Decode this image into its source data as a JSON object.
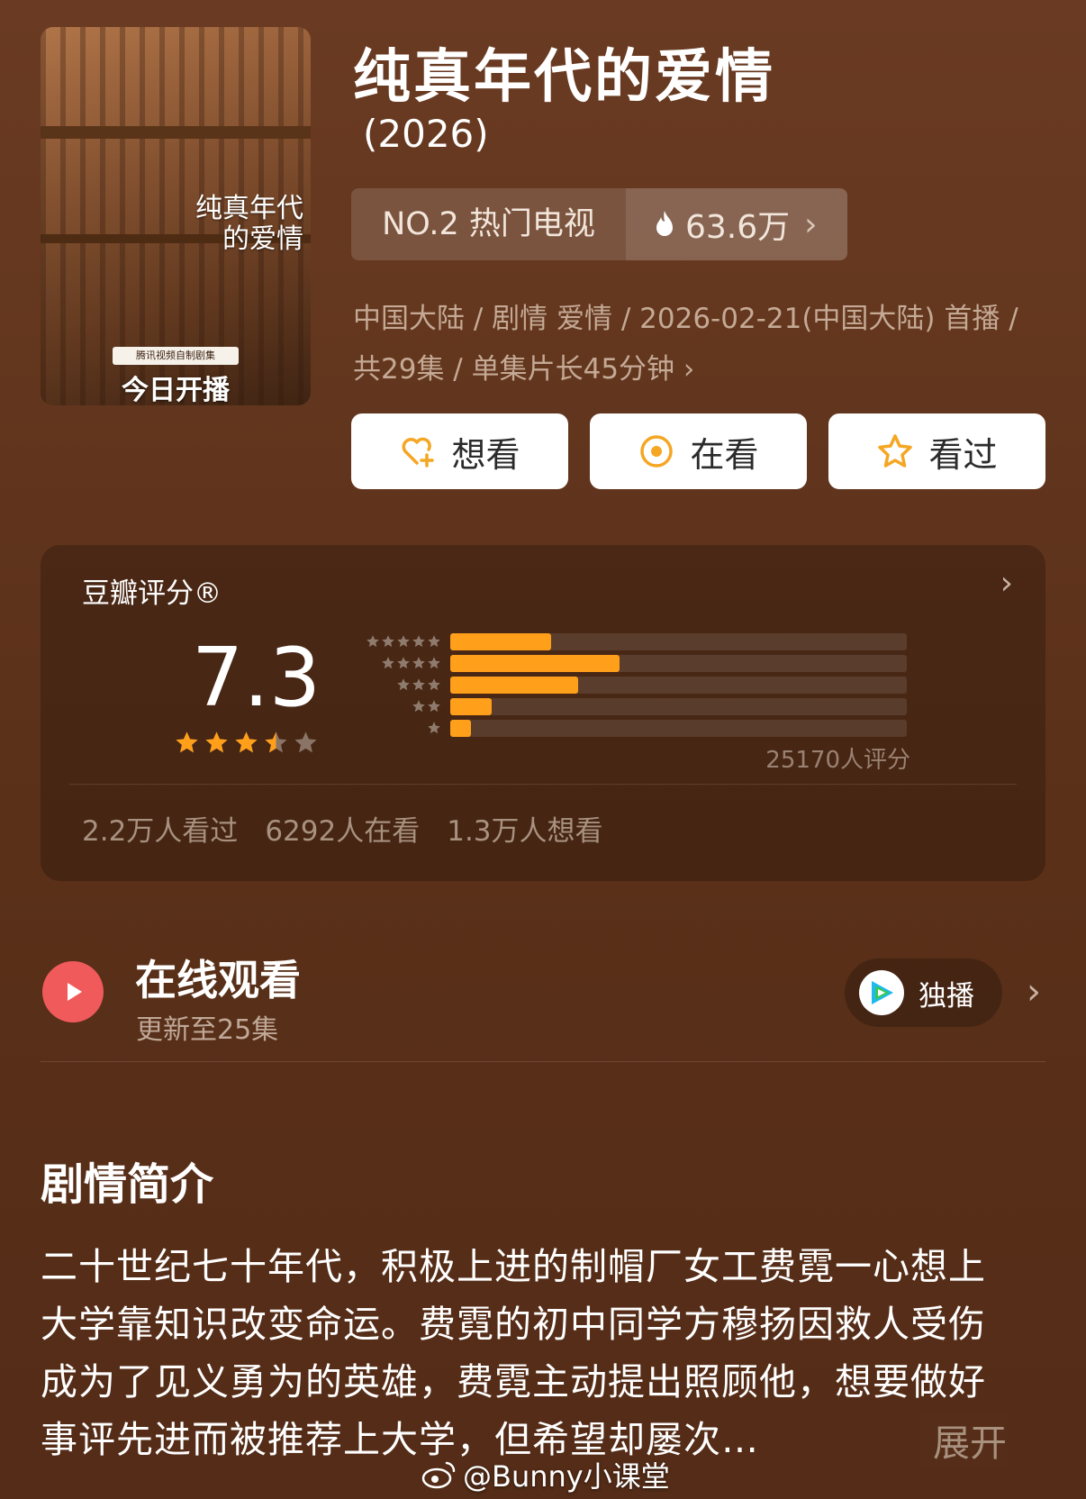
{
  "poster": {
    "title_art": "纯真年代的爱情",
    "tag": "腾讯视频自制剧集",
    "cta": "今日开播"
  },
  "header": {
    "title": "纯真年代的爱情",
    "year": "(2026)"
  },
  "rank": {
    "label": "NO.2 热门电视",
    "heat": "63.6万",
    "heat_icon": "fire-icon"
  },
  "meta": {
    "line1": "中国大陆 / 剧情 爱情 / 2026-02-21(中国大陆) 首播 /",
    "line2": "共29集 / 单集片长45分钟"
  },
  "actions": {
    "want": "想看",
    "watching": "在看",
    "watched": "看过"
  },
  "rating": {
    "label": "豆瓣评分®",
    "score": "7.3",
    "stars_value": 3.5,
    "count_text": "25170人评分",
    "distribution": [
      {
        "stars": 5,
        "fraction": 0.22
      },
      {
        "stars": 4,
        "fraction": 0.37
      },
      {
        "stars": 3,
        "fraction": 0.28
      },
      {
        "stars": 2,
        "fraction": 0.09
      },
      {
        "stars": 1,
        "fraction": 0.045
      }
    ],
    "stats": {
      "watched": "2.2万人看过",
      "watching": "6292人在看",
      "want": "1.3万人想看"
    }
  },
  "online": {
    "title": "在线观看",
    "subtitle": "更新至25集",
    "provider_label": "独播"
  },
  "synopsis": {
    "heading": "剧情简介",
    "text": "二十世纪七十年代，积极上进的制帽厂女工费霓一心想上大学靠知识改变命运。费霓的初中同学方穆扬因救人受伤成为了见义勇为的英雄，费霓主动提出照顾他，想要做好事评先进而被推荐上大学，但希望却屡次…",
    "expand": "展开"
  },
  "watermark": {
    "text": "@Bunny小课堂"
  },
  "colors": {
    "accent_orange": "#ff9f1a",
    "play_red": "#f15a5a",
    "background": "#5a3019"
  }
}
